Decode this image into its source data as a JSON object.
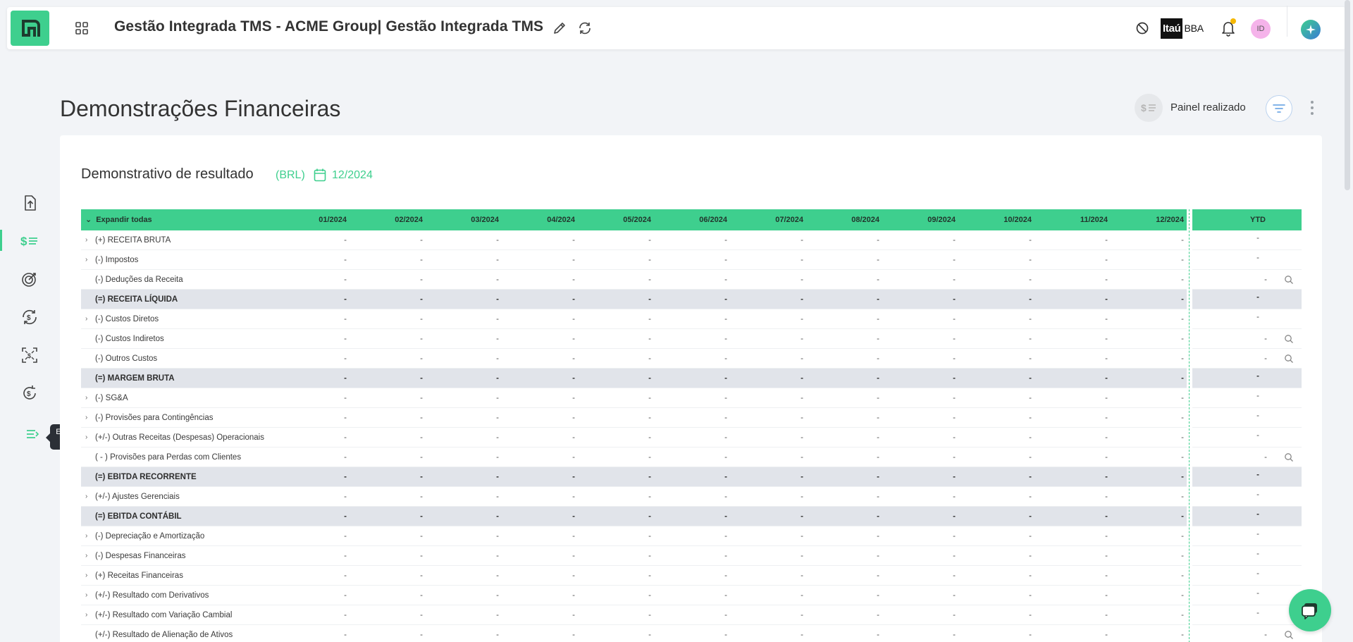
{
  "app": {
    "title": "Gestão Integrada TMS - ACME Group| Gestão Integrada TMS",
    "bank_logo_a": "Itaú",
    "bank_logo_b": "BBA",
    "avatar_initials": "ID",
    "accent_color": "#3ecf8e"
  },
  "page": {
    "title": "Demonstrações Financeiras",
    "panel_label": "Painel realizado"
  },
  "sidebar": {
    "tooltip": "Expandir menu",
    "items": [
      "file-upload-icon",
      "dollar-list-icon",
      "target-dollar-icon",
      "dollar-cycle-icon",
      "dollar-scan-icon",
      "dollar-refresh-icon",
      "expand-menu-icon"
    ]
  },
  "card": {
    "title": "Demonstrativo de resultado",
    "currency": "(BRL)",
    "date": "12/2024"
  },
  "table": {
    "expand_all": "Expandir todas",
    "columns": [
      "01/2024",
      "02/2024",
      "03/2024",
      "04/2024",
      "05/2024",
      "06/2024",
      "07/2024",
      "08/2024",
      "09/2024",
      "10/2024",
      "11/2024",
      "12/2024"
    ],
    "ytd_label": "YTD",
    "rows": [
      {
        "label": "(+) RECEITA BRUTA",
        "expandable": true,
        "total": false,
        "search": false,
        "values": [
          "-",
          "-",
          "-",
          "-",
          "-",
          "-",
          "-",
          "-",
          "-",
          "-",
          "-",
          "-"
        ],
        "ytd": "-"
      },
      {
        "label": "(-) Impostos",
        "expandable": true,
        "total": false,
        "search": false,
        "values": [
          "-",
          "-",
          "-",
          "-",
          "-",
          "-",
          "-",
          "-",
          "-",
          "-",
          "-",
          "-"
        ],
        "ytd": "-"
      },
      {
        "label": "(-) Deduções da Receita",
        "expandable": false,
        "total": false,
        "search": true,
        "values": [
          "-",
          "-",
          "-",
          "-",
          "-",
          "-",
          "-",
          "-",
          "-",
          "-",
          "-",
          "-"
        ],
        "ytd": "-"
      },
      {
        "label": "(=) RECEITA LÍQUIDA",
        "expandable": false,
        "total": true,
        "search": false,
        "values": [
          "-",
          "-",
          "-",
          "-",
          "-",
          "-",
          "-",
          "-",
          "-",
          "-",
          "-",
          "-"
        ],
        "ytd": "-"
      },
      {
        "label": "(-) Custos Diretos",
        "expandable": true,
        "total": false,
        "search": false,
        "values": [
          "-",
          "-",
          "-",
          "-",
          "-",
          "-",
          "-",
          "-",
          "-",
          "-",
          "-",
          "-"
        ],
        "ytd": "-"
      },
      {
        "label": "(-) Custos Indiretos",
        "expandable": false,
        "total": false,
        "search": true,
        "values": [
          "-",
          "-",
          "-",
          "-",
          "-",
          "-",
          "-",
          "-",
          "-",
          "-",
          "-",
          "-"
        ],
        "ytd": "-"
      },
      {
        "label": "(-) Outros Custos",
        "expandable": false,
        "total": false,
        "search": true,
        "values": [
          "-",
          "-",
          "-",
          "-",
          "-",
          "-",
          "-",
          "-",
          "-",
          "-",
          "-",
          "-"
        ],
        "ytd": "-"
      },
      {
        "label": "(=) MARGEM BRUTA",
        "expandable": false,
        "total": true,
        "search": false,
        "values": [
          "-",
          "-",
          "-",
          "-",
          "-",
          "-",
          "-",
          "-",
          "-",
          "-",
          "-",
          "-"
        ],
        "ytd": "-"
      },
      {
        "label": "(-) SG&A",
        "expandable": true,
        "total": false,
        "search": false,
        "values": [
          "-",
          "-",
          "-",
          "-",
          "-",
          "-",
          "-",
          "-",
          "-",
          "-",
          "-",
          "-"
        ],
        "ytd": "-"
      },
      {
        "label": "(-) Provisões para Contingências",
        "expandable": true,
        "total": false,
        "search": false,
        "values": [
          "-",
          "-",
          "-",
          "-",
          "-",
          "-",
          "-",
          "-",
          "-",
          "-",
          "-",
          "-"
        ],
        "ytd": "-"
      },
      {
        "label": "(+/-) Outras Receitas (Despesas) Operacionais",
        "expandable": true,
        "total": false,
        "search": false,
        "values": [
          "-",
          "-",
          "-",
          "-",
          "-",
          "-",
          "-",
          "-",
          "-",
          "-",
          "-",
          "-"
        ],
        "ytd": "-"
      },
      {
        "label": "( - ) Provisões para Perdas com Clientes",
        "expandable": false,
        "total": false,
        "search": true,
        "values": [
          "-",
          "-",
          "-",
          "-",
          "-",
          "-",
          "-",
          "-",
          "-",
          "-",
          "-",
          "-"
        ],
        "ytd": "-"
      },
      {
        "label": "(=) EBITDA RECORRENTE",
        "expandable": false,
        "total": true,
        "search": false,
        "values": [
          "-",
          "-",
          "-",
          "-",
          "-",
          "-",
          "-",
          "-",
          "-",
          "-",
          "-",
          "-"
        ],
        "ytd": "-"
      },
      {
        "label": "(+/-) Ajustes Gerenciais",
        "expandable": true,
        "total": false,
        "search": false,
        "values": [
          "-",
          "-",
          "-",
          "-",
          "-",
          "-",
          "-",
          "-",
          "-",
          "-",
          "-",
          "-"
        ],
        "ytd": "-"
      },
      {
        "label": "(=) EBITDA CONTÁBIL",
        "expandable": false,
        "total": true,
        "search": false,
        "values": [
          "-",
          "-",
          "-",
          "-",
          "-",
          "-",
          "-",
          "-",
          "-",
          "-",
          "-",
          "-"
        ],
        "ytd": "-"
      },
      {
        "label": "(-) Depreciação e Amortização",
        "expandable": true,
        "total": false,
        "search": false,
        "values": [
          "-",
          "-",
          "-",
          "-",
          "-",
          "-",
          "-",
          "-",
          "-",
          "-",
          "-",
          "-"
        ],
        "ytd": "-"
      },
      {
        "label": "(-) Despesas Financeiras",
        "expandable": true,
        "total": false,
        "search": false,
        "values": [
          "-",
          "-",
          "-",
          "-",
          "-",
          "-",
          "-",
          "-",
          "-",
          "-",
          "-",
          "-"
        ],
        "ytd": "-"
      },
      {
        "label": "(+) Receitas Financeiras",
        "expandable": true,
        "total": false,
        "search": false,
        "values": [
          "-",
          "-",
          "-",
          "-",
          "-",
          "-",
          "-",
          "-",
          "-",
          "-",
          "-",
          "-"
        ],
        "ytd": "-"
      },
      {
        "label": "(+/-) Resultado com Derivativos",
        "expandable": true,
        "total": false,
        "search": false,
        "values": [
          "-",
          "-",
          "-",
          "-",
          "-",
          "-",
          "-",
          "-",
          "-",
          "-",
          "-",
          "-"
        ],
        "ytd": "-"
      },
      {
        "label": "(+/-) Resultado com Variação Cambial",
        "expandable": true,
        "total": false,
        "search": false,
        "values": [
          "-",
          "-",
          "-",
          "-",
          "-",
          "-",
          "-",
          "-",
          "-",
          "-",
          "-",
          "-"
        ],
        "ytd": "-"
      },
      {
        "label": "(+/-) Resultado de Alienação de Ativos",
        "expandable": false,
        "total": false,
        "search": true,
        "values": [
          "-",
          "-",
          "-",
          "-",
          "-",
          "-",
          "-",
          "-",
          "-",
          "-",
          "-",
          "-"
        ],
        "ytd": "-"
      }
    ]
  }
}
